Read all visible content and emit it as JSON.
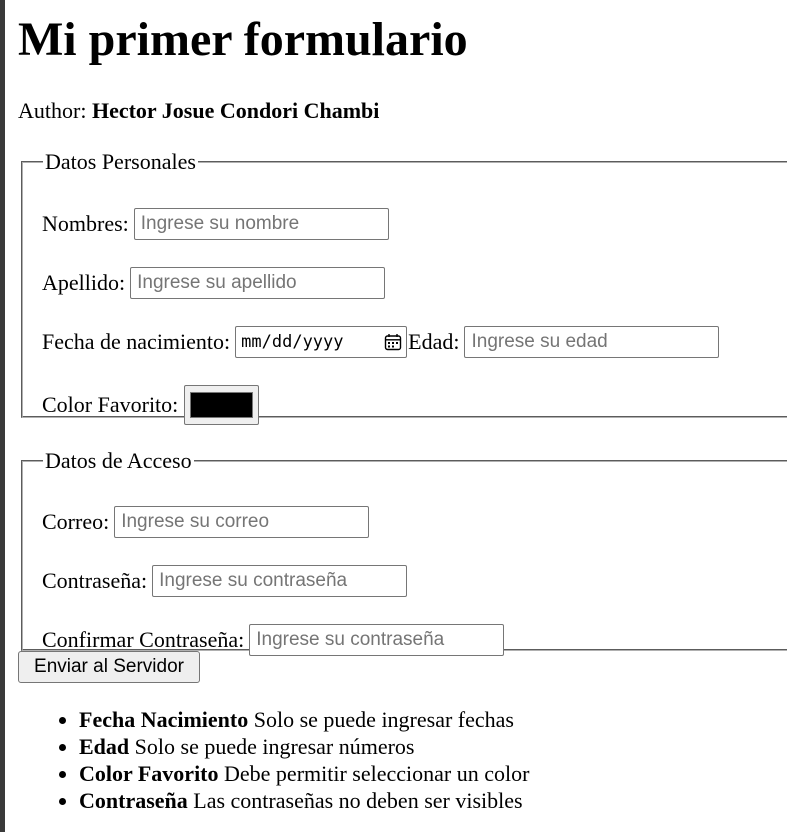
{
  "page": {
    "title": "Mi primer formulario",
    "author_label": "Author:",
    "author_name": "Hector Josue Condori Chambi"
  },
  "personal": {
    "legend": "Datos Personales",
    "nombres_label": "Nombres:",
    "nombres_placeholder": "Ingrese su nombre",
    "apellido_label": "Apellido:",
    "apellido_placeholder": "Ingrese su apellido",
    "fecha_label": "Fecha de nacimiento:",
    "fecha_value": "mm/dd/yyyy",
    "edad_label": "Edad:",
    "edad_placeholder": "Ingrese su edad",
    "color_label": "Color Favorito:",
    "color_value": "#000000"
  },
  "access": {
    "legend": "Datos de Acceso",
    "correo_label": "Correo:",
    "correo_placeholder": "Ingrese su correo",
    "password_label": "Contraseña:",
    "password_placeholder": "Ingrese su contraseña",
    "confirm_label": "Confirmar Contraseña:",
    "confirm_placeholder": "Ingrese su contraseña"
  },
  "submit_label": "Enviar al Servidor",
  "notes": [
    {
      "term": "Fecha Nacimiento",
      "text": " Solo se puede ingresar fechas"
    },
    {
      "term": "Edad",
      "text": " Solo se puede ingresar números"
    },
    {
      "term": "Color Favorito",
      "text": " Debe permitir seleccionar un color"
    },
    {
      "term": "Contraseña",
      "text": " Las contraseñas no deben ser visibles"
    }
  ],
  "icons": {
    "date_picker": "calendar-icon"
  }
}
